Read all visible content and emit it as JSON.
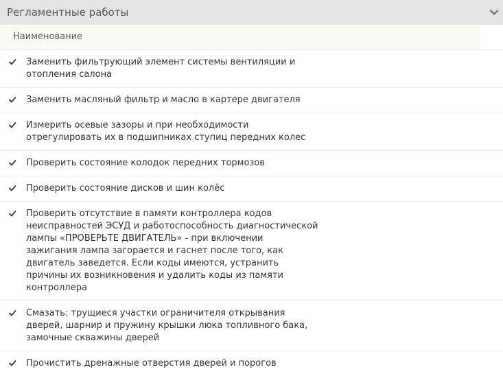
{
  "section": {
    "title": "Регламентные работы",
    "toggle_icon": "chevron-down-icon"
  },
  "table": {
    "column_header": "Наименование",
    "check_icon": "check-icon",
    "items": [
      {
        "lines": [
          "Заменить фильтрующий элемент системы вентиляции и",
          "отопления салона"
        ]
      },
      {
        "lines": [
          "Заменить масляный фильтр и масло в картере двигателя"
        ]
      },
      {
        "lines": [
          "Измерить осевые зазоры и при необходимости",
          "отрегулировать их в подшипниках ступиц передних колес"
        ]
      },
      {
        "lines": [
          "Проверить состояние колодок передних тормозов"
        ]
      },
      {
        "lines": [
          "Проверить состояние дисков и шин колёс"
        ]
      },
      {
        "lines": [
          "Проверить отсутствие в памяти контроллера кодов",
          "неисправностей ЭСУД и работоспособность диагностической",
          "лампы «ПРОВЕРЬТЕ ДВИГАТЕЛЬ» - при включении",
          "зажигания лампа загорается и гаснет после того, как",
          "двигатель заведется. Если коды имеются, устранить",
          "причины их возникновения и удалить коды из памяти",
          "контроллера"
        ]
      },
      {
        "lines": [
          "Смазать: трущиеся участки ограничителя открывания",
          "дверей, шарнир и пружину крышки люка топливного бака,",
          "замочные скважины дверей"
        ]
      },
      {
        "lines": [
          "Прочистить дренажные отверстия дверей и порогов"
        ]
      }
    ]
  }
}
